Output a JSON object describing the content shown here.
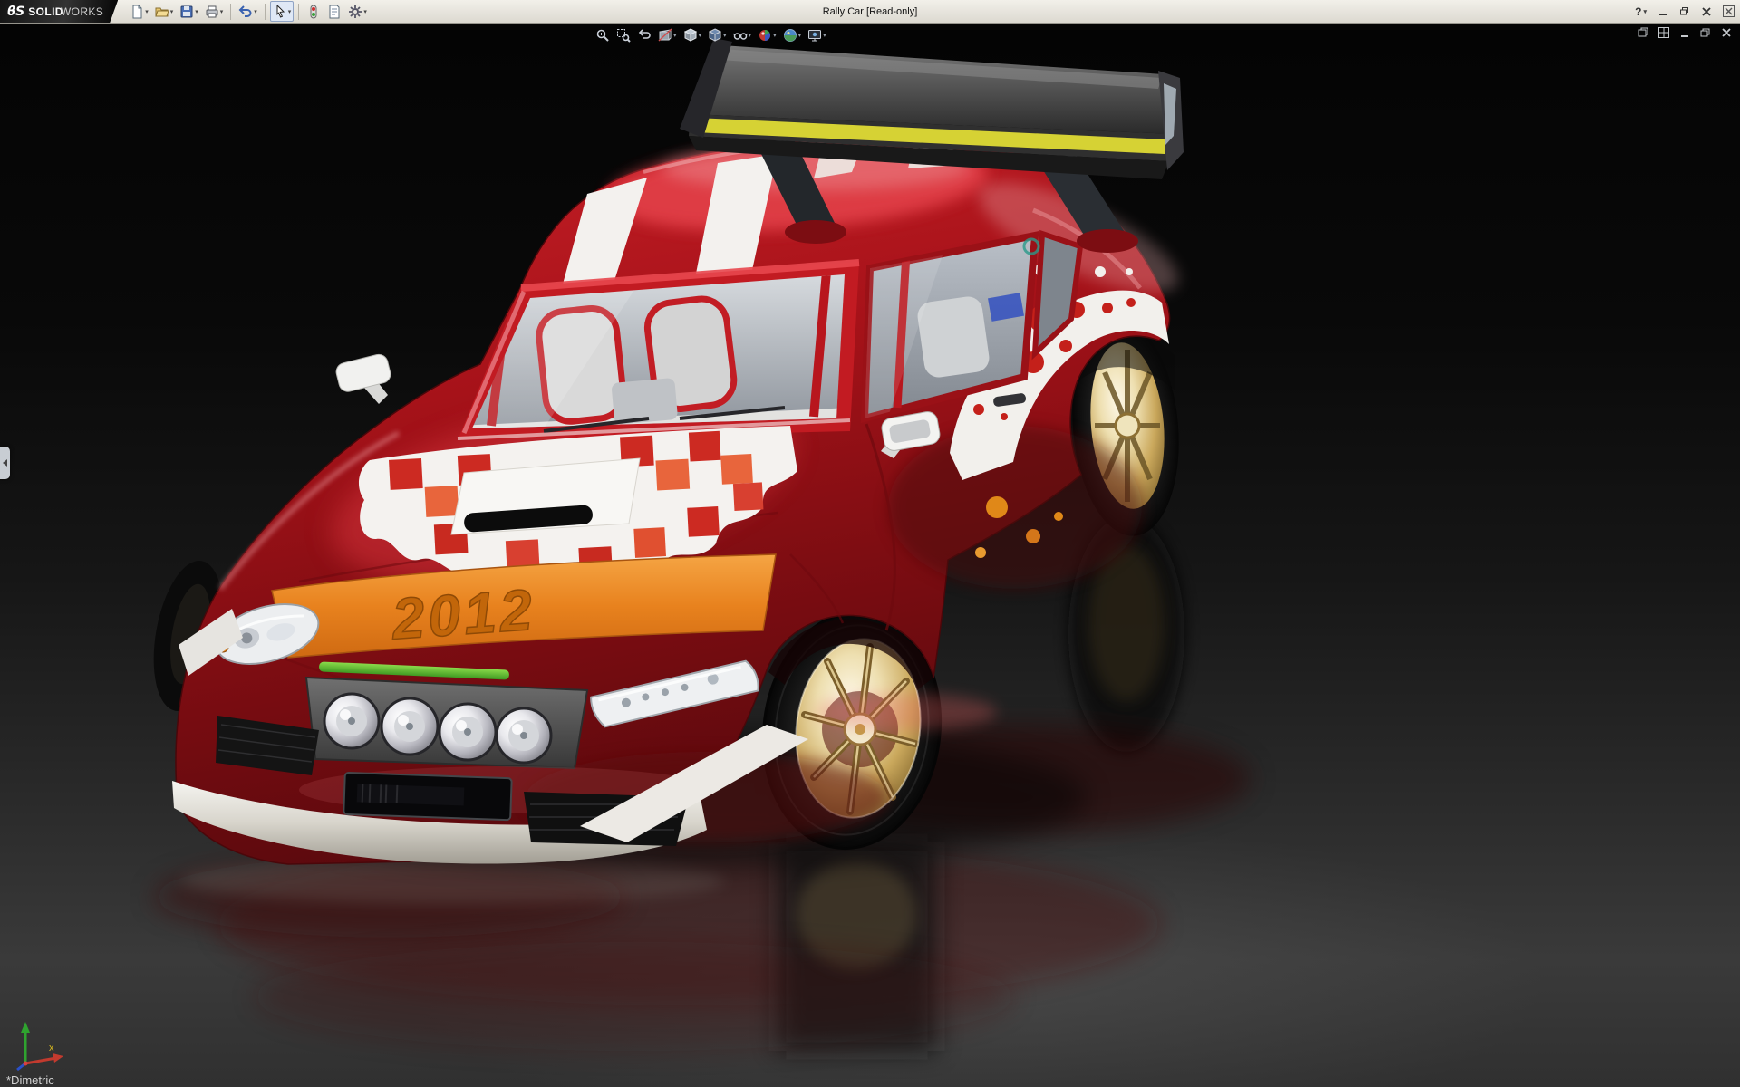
{
  "window": {
    "brand_glyph": "ϐS",
    "brand_solid": "SOLID",
    "brand_works": "WORKS",
    "title": "Rally Car [Read-only]"
  },
  "toolbar": {
    "icons": [
      "new-document",
      "open",
      "save",
      "print",
      "undo",
      "select",
      "rebuild",
      "file-properties",
      "options"
    ],
    "help_label": "?"
  },
  "hud": {
    "icons": [
      "zoom-to-fit",
      "zoom-to-area",
      "previous-view",
      "section-view",
      "view-orientation",
      "display-style",
      "hide-show-items",
      "edit-appearance",
      "apply-scene",
      "view-settings"
    ]
  },
  "doc_controls": {
    "icons": [
      "cascade-windows",
      "tile-windows",
      "minimize-document",
      "restore-document",
      "close-document"
    ]
  },
  "viewport": {
    "orientation_label": "*Dimetric",
    "triad": {
      "x_label": "x"
    }
  },
  "car": {
    "year_decal": "2012"
  },
  "colors": {
    "body_red": "#a31219",
    "stripe_white": "#f3f1ee",
    "accent_orange": "#e8821e",
    "decal_orange_text": "#c2660a",
    "wing_stripe_yellow": "#d6d234",
    "led_green": "#58b434",
    "rim_gold": "#caa85c",
    "viewport_top": "#050505",
    "viewport_bottom": "#383838",
    "titlebar_bg": "#e9e7e0"
  }
}
